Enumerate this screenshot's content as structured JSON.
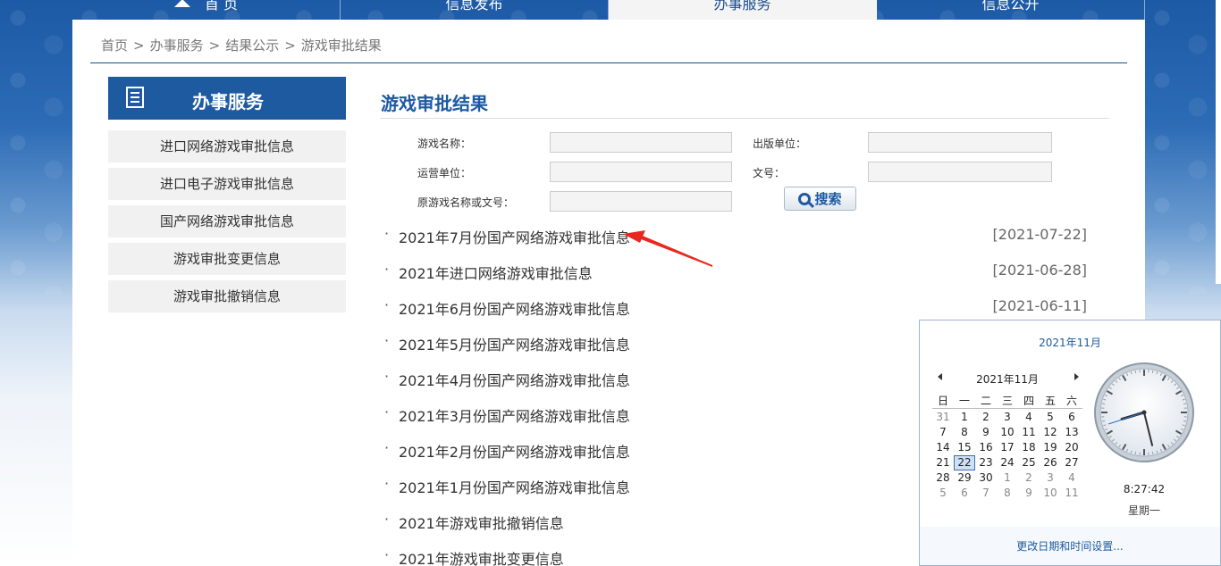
{
  "nav": {
    "home": "首 页",
    "items": [
      "信息发布",
      "办事服务",
      "信息公开"
    ]
  },
  "breadcrumb": [
    "首页",
    "办事服务",
    "结果公示",
    "游戏审批结果"
  ],
  "breadcrumb_sep": ">",
  "sidebar": {
    "title": "办事服务",
    "items": [
      "进口网络游戏审批信息",
      "进口电子游戏审批信息",
      "国产网络游戏审批信息",
      "游戏审批变更信息",
      "游戏审批撤销信息"
    ]
  },
  "main": {
    "title": "游戏审批结果",
    "form": {
      "game_name_label": "游戏名称：",
      "publisher_label": "出版单位：",
      "operator_label": "运营单位：",
      "doc_no_label": "文号：",
      "orig_label": "原游戏名称或文号：",
      "search_label": "搜索"
    },
    "list": [
      {
        "text": "2021年7月份国产网络游戏审批信息",
        "date": "[2021-07-22]"
      },
      {
        "text": "2021年进口网络游戏审批信息",
        "date": "[2021-06-28]"
      },
      {
        "text": "2021年6月份国产网络游戏审批信息",
        "date": "[2021-06-11]"
      },
      {
        "text": "2021年5月份国产网络游戏审批信息",
        "date": ""
      },
      {
        "text": "2021年4月份国产网络游戏审批信息",
        "date": ""
      },
      {
        "text": "2021年3月份国产网络游戏审批信息",
        "date": ""
      },
      {
        "text": "2021年2月份国产网络游戏审批信息",
        "date": ""
      },
      {
        "text": "2021年1月份国产网络游戏审批信息",
        "date": ""
      },
      {
        "text": "2021年游戏审批撤销信息",
        "date": ""
      },
      {
        "text": "2021年游戏审批变更信息",
        "date": ""
      }
    ],
    "bullet": "·"
  },
  "calendar": {
    "header_link": "2021年11月",
    "month_label": "2021年11月",
    "weekdays": [
      "日",
      "一",
      "二",
      "三",
      "四",
      "五",
      "六"
    ],
    "weeks": [
      [
        "31",
        "1",
        "2",
        "3",
        "4",
        "5",
        "6"
      ],
      [
        "7",
        "8",
        "9",
        "10",
        "11",
        "12",
        "13"
      ],
      [
        "14",
        "15",
        "16",
        "17",
        "18",
        "19",
        "20"
      ],
      [
        "21",
        "22",
        "23",
        "24",
        "25",
        "26",
        "27"
      ],
      [
        "28",
        "29",
        "30",
        "1",
        "2",
        "3",
        "4"
      ],
      [
        "5",
        "6",
        "7",
        "8",
        "9",
        "10",
        "11"
      ]
    ],
    "today": "22",
    "time": "8:27:42",
    "weekday_label": "星期一",
    "settings_link": "更改日期和时间设置...",
    "clock": {
      "hour": 8,
      "minute": 27,
      "second": 42
    }
  },
  "colors": {
    "brand_blue": "#1e5aa0",
    "arrow_red": "#e8281e"
  }
}
